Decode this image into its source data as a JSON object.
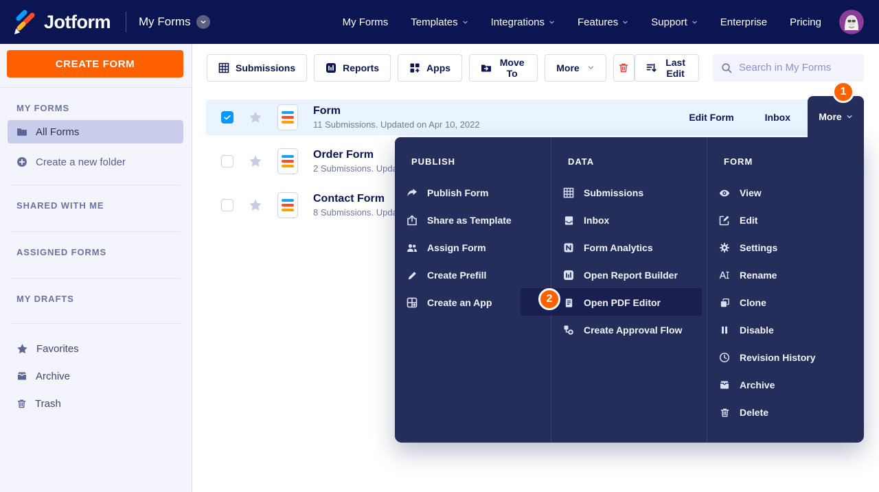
{
  "header": {
    "brand": "Jotform",
    "workspace": "My Forms",
    "nav": [
      {
        "label": "My Forms"
      },
      {
        "label": "Templates"
      },
      {
        "label": "Integrations"
      },
      {
        "label": "Features"
      },
      {
        "label": "Support"
      },
      {
        "label": "Enterprise"
      },
      {
        "label": "Pricing"
      }
    ]
  },
  "sidebar": {
    "create_form_label": "CREATE FORM",
    "my_forms_heading": "MY FORMS",
    "all_forms_label": "All Forms",
    "create_folder_label": "Create a new folder",
    "shared_with_me_heading": "SHARED WITH ME",
    "assigned_forms_heading": "ASSIGNED FORMS",
    "my_drafts_heading": "MY DRAFTS",
    "favorites_label": "Favorites",
    "archive_label": "Archive",
    "trash_label": "Trash"
  },
  "toolbar": {
    "submissions_label": "Submissions",
    "reports_label": "Reports",
    "apps_label": "Apps",
    "move_to_label": "Move To",
    "more_label": "More",
    "sort_label": "Last Edit",
    "search_placeholder": "Search in My Forms"
  },
  "form_list": {
    "rows": [
      {
        "title": "Form",
        "subtitle": "11 Submissions. Updated on Apr 10, 2022",
        "checked": true,
        "edit_label": "Edit Form",
        "inbox_label": "Inbox",
        "more_label": "More"
      },
      {
        "title": "Order Form",
        "subtitle": "2 Submissions. Upda",
        "checked": false
      },
      {
        "title": "Contact Form",
        "subtitle": "8 Submissions. Upda",
        "checked": false
      }
    ]
  },
  "menu": {
    "publish": {
      "heading": "PUBLISH",
      "items": [
        {
          "label": "Publish Form",
          "icon": "share-arrow-icon"
        },
        {
          "label": "Share as Template",
          "icon": "export-icon"
        },
        {
          "label": "Assign Form",
          "icon": "users-icon"
        },
        {
          "label": "Create Prefill",
          "icon": "pencil-icon"
        },
        {
          "label": "Create an App",
          "icon": "app-window-icon"
        }
      ]
    },
    "data": {
      "heading": "DATA",
      "items": [
        {
          "label": "Submissions",
          "icon": "table-icon"
        },
        {
          "label": "Inbox",
          "icon": "inbox-icon"
        },
        {
          "label": "Form Analytics",
          "icon": "analytics-icon"
        },
        {
          "label": "Open Report Builder",
          "icon": "report-icon"
        },
        {
          "label": "Open PDF Editor",
          "icon": "pdf-document-icon",
          "highlighted": true
        },
        {
          "label": "Create Approval Flow",
          "icon": "approval-flow-icon"
        }
      ]
    },
    "form": {
      "heading": "FORM",
      "items": [
        {
          "label": "View",
          "icon": "eye-icon"
        },
        {
          "label": "Edit",
          "icon": "edit-icon"
        },
        {
          "label": "Settings",
          "icon": "gear-icon"
        },
        {
          "label": "Rename",
          "icon": "rename-icon"
        },
        {
          "label": "Clone",
          "icon": "clone-icon"
        },
        {
          "label": "Disable",
          "icon": "pause-icon"
        },
        {
          "label": "Revision History",
          "icon": "clock-icon"
        },
        {
          "label": "Archive",
          "icon": "archive-icon"
        },
        {
          "label": "Delete",
          "icon": "trash-icon"
        }
      ]
    }
  },
  "annotations": {
    "step_1": "1",
    "step_2": "2"
  },
  "colors": {
    "navbar": "#0a1551",
    "accent_orange": "#ff6100",
    "menu_bg": "#252e5a",
    "menu_highlight": "#191f4e",
    "selected_row": "#e9f4fe",
    "checkbox_blue": "#0099ff",
    "star_yellow": "#ffb629",
    "danger_red": "#e8413d",
    "sidebar_bg": "#f4f4fc"
  }
}
